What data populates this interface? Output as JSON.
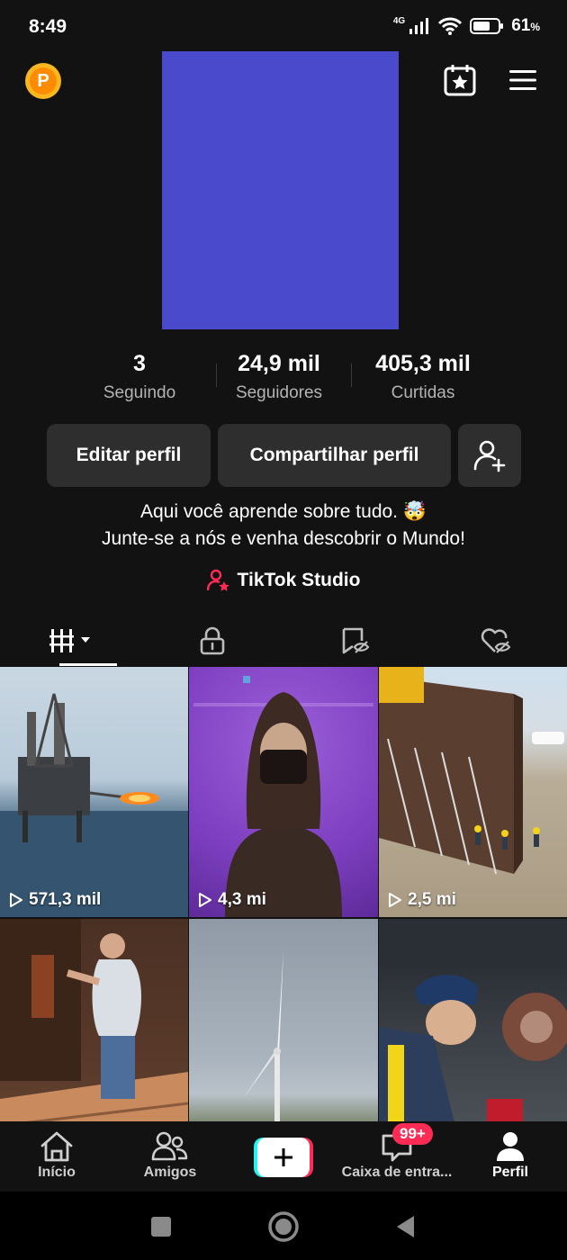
{
  "status_bar": {
    "time": "8:49",
    "network": "4G",
    "battery": "61",
    "battery_unit": "%"
  },
  "profile": {
    "stats": [
      {
        "value": "3",
        "label": "Seguindo"
      },
      {
        "value": "24,9 mil",
        "label": "Seguidores"
      },
      {
        "value": "405,3 mil",
        "label": "Curtidas"
      }
    ],
    "edit_label": "Editar perfil",
    "share_label": "Compartilhar perfil",
    "bio_line1": "Aqui você aprende sobre tudo. 🤯",
    "bio_line2": "Junte-se a nós e venha descobrir o Mundo!",
    "studio_label": "TikTok Studio"
  },
  "coin_letter": "P",
  "videos": [
    {
      "views": "571,3 mil"
    },
    {
      "views": "4,3 mi"
    },
    {
      "views": "2,5 mi"
    }
  ],
  "bottom_nav": {
    "home": "Início",
    "friends": "Amigos",
    "inbox": "Caixa de entra...",
    "inbox_badge": "99+",
    "profile": "Perfil"
  },
  "colors": {
    "avatar": "#4a4bcc",
    "accent": "#fe2c55",
    "background": "#121212"
  }
}
